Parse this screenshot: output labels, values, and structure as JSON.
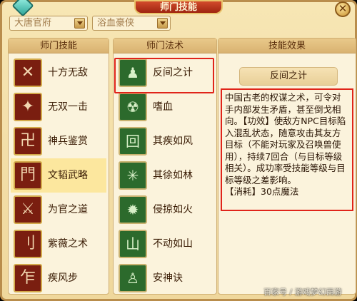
{
  "title": "师门技能",
  "dropdowns": [
    {
      "value": "大唐官府"
    },
    {
      "value": "浴血豪侠"
    }
  ],
  "columns": {
    "skills_header": "师门技能",
    "spells_header": "师门法术",
    "effect_header": "技能效果"
  },
  "skills": [
    {
      "label": "十方无敌",
      "icon": "crossed-axes-icon",
      "glyph": "✕"
    },
    {
      "label": "无双一击",
      "icon": "skull-strike-icon",
      "glyph": "✦"
    },
    {
      "label": "神兵鉴赏",
      "icon": "weapon-scroll-icon",
      "glyph": "卍"
    },
    {
      "label": "文韬武略",
      "icon": "gate-icon",
      "glyph": "門"
    },
    {
      "label": "为官之道",
      "icon": "crossed-swords-icon",
      "glyph": "⚔"
    },
    {
      "label": "紫薇之术",
      "icon": "rune-icon",
      "glyph": "刂"
    },
    {
      "label": "疾风步",
      "icon": "wind-step-icon",
      "glyph": "乍"
    }
  ],
  "spells": [
    {
      "label": "反间之计",
      "icon": "two-figures-icon",
      "glyph": "♟"
    },
    {
      "label": "嗜血",
      "icon": "blood-icon",
      "glyph": "☢"
    },
    {
      "label": "其疾如风",
      "icon": "wind-icon",
      "glyph": "回"
    },
    {
      "label": "其徐如林",
      "icon": "forest-icon",
      "glyph": "✳"
    },
    {
      "label": "侵掠如火",
      "icon": "fire-icon",
      "glyph": "✹"
    },
    {
      "label": "不动如山",
      "icon": "mountain-icon",
      "glyph": "山"
    },
    {
      "label": "安神诀",
      "icon": "meditation-icon",
      "glyph": "♙"
    }
  ],
  "selected_skill_index": 3,
  "selected_spell_index": 0,
  "effect": {
    "name": "反间之计",
    "intro": "中国古老的权谋之术，可令对手内部发生矛盾，甚至倒戈相向。",
    "effect_tag": "【功效】",
    "effect_text": "使敌方NPC目标陷入混乱状态，随意攻击其友方目标（不能对玩家及召唤兽使用），持续7回合（与目标等级相关）。成功率受技能等级与目标等级之差影响。",
    "cost_tag": "【消耗】",
    "cost_text": "30点魔法"
  },
  "watermark": "百家号 / 游戏梦幻西游",
  "colors": {
    "highlight": "#e0241a",
    "title_plate": "#b8321a",
    "panel_bg": "#fbf3dc"
  }
}
